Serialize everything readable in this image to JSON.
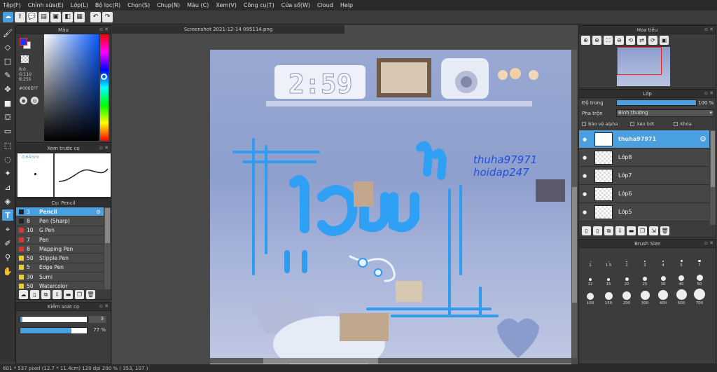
{
  "menu": [
    "Tệp(F)",
    "Chỉnh sửa(E)",
    "Lớp(L)",
    "Bộ lọc(R)",
    "Chọn(S)",
    "Chụp(N)",
    "Màu (C)",
    "Xem(V)",
    "Công cụ(T)",
    "Cửa sổ(W)",
    "Cloud",
    "Help"
  ],
  "color_panel": {
    "title": "Màu",
    "r": "R:0",
    "g": "G:110",
    "b": "B:255",
    "hex": "#006EFF",
    "fg": "#006EFF",
    "bg": "#ffffff"
  },
  "brush_preview": {
    "title": "Xem trước cọ",
    "size": "0.64mm"
  },
  "brush_panel": {
    "title": "Cọ: Pencil",
    "items": [
      {
        "size": "3",
        "name": "Pencil",
        "color": "#222222"
      },
      {
        "size": "8",
        "name": "Pen (Sharp)",
        "color": "#222222"
      },
      {
        "size": "10",
        "name": "G Pen",
        "color": "#e53030"
      },
      {
        "size": "7",
        "name": "Pen",
        "color": "#e53030"
      },
      {
        "size": "8",
        "name": "Mapping Pen",
        "color": "#e53030"
      },
      {
        "size": "50",
        "name": "Stipple Pen",
        "color": "#f0d020"
      },
      {
        "size": "5",
        "name": "Edge Pen",
        "color": "#f0d020"
      },
      {
        "size": "30",
        "name": "Sumi",
        "color": "#f0d020"
      },
      {
        "size": "50",
        "name": "Watercolor",
        "color": "#f0d020"
      }
    ]
  },
  "brush_control": {
    "title": "Kiểm soát cọ",
    "size_value": "3",
    "opacity_value": "77 %",
    "opacity_fraction": 0.77,
    "size_fraction": 0.03
  },
  "document": {
    "tab": "Screenshot 2021-12-14 095114.png",
    "clock": "2:59",
    "text1": "thuha97971",
    "text2": "hoidap247"
  },
  "navigator": {
    "title": "Hoa tiêu"
  },
  "layers": {
    "title": "Lớp",
    "opacity_label": "Độ trong",
    "opacity_value": "100 %",
    "opacity_fraction": 1.0,
    "blend_label": "Pha trộn",
    "blend_value": "Bình thường",
    "protect_alpha": "Bảo vệ alpha",
    "clipping": "Xén bớt",
    "lock": "Khóa",
    "items": [
      {
        "name": "thuha97971",
        "selected": true
      },
      {
        "name": "Lớp8",
        "selected": false
      },
      {
        "name": "Lớp7",
        "selected": false
      },
      {
        "name": "Lớp6",
        "selected": false
      },
      {
        "name": "Lớp5",
        "selected": false
      }
    ]
  },
  "brush_size": {
    "title": "Brush Size",
    "rows": [
      [
        "1",
        "1.5",
        "2",
        "3",
        "4",
        "5",
        "7"
      ],
      [
        "12",
        "15",
        "20",
        "25",
        "30",
        "40",
        "50"
      ],
      [
        "100",
        "150",
        "200",
        "300",
        "400",
        "500",
        "700"
      ]
    ]
  },
  "status": "601 * 537 pixel   (12.7 * 11.4cm)   120 dpi   200 %   ( 353, 107 )"
}
